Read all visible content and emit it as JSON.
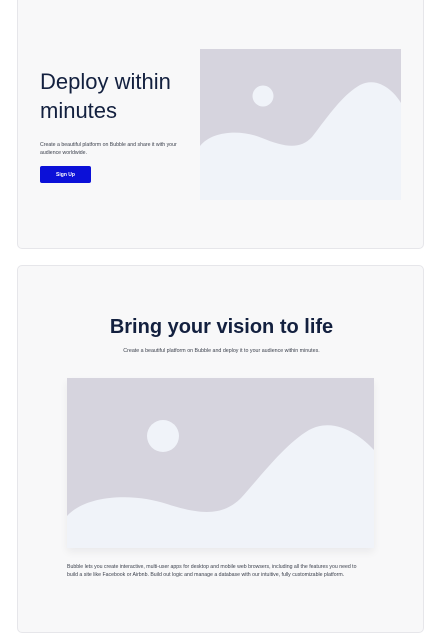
{
  "colors": {
    "card_background": "#f8f8f9",
    "card_border": "#e6e6ea",
    "heading_text": "#13203f",
    "body_text": "#3a3f4b",
    "button_background": "#0b10d8",
    "button_text": "#ffffff",
    "placeholder_back": "#d6d4de",
    "placeholder_front": "#f0f3f9"
  },
  "hero": {
    "title": "Deploy within minutes",
    "description": "Create a beautiful platform on Bubble and share it with your audience worldwide.",
    "signup_label": "Sign Up",
    "image_icon": "image-placeholder-icon"
  },
  "feature": {
    "title": "Bring your vision to life",
    "subtitle": "Create a beautiful platform on Bubble and deploy it to your audience within minutes.",
    "image_icon": "image-placeholder-icon",
    "body": "Bubble lets you create interactive, multi-user apps for desktop and mobile web browsers, including all the features you need to build a site like Facebook or Airbnb. Build out logic and manage a database with our intuitive, fully customizable platform."
  }
}
